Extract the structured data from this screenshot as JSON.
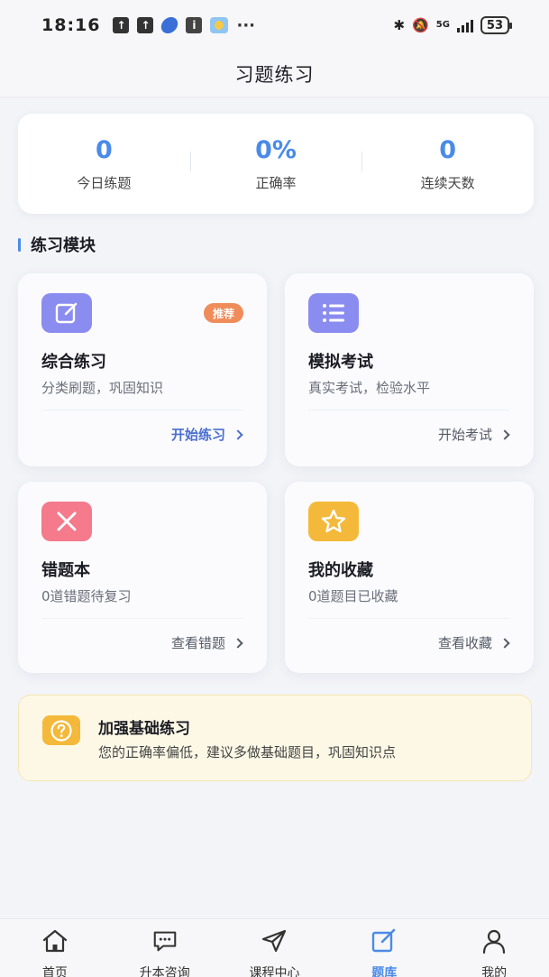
{
  "status_bar": {
    "time": "18:16",
    "network": "5G",
    "battery": "53"
  },
  "nav": {
    "title": "习题练习"
  },
  "stats": [
    {
      "value": "0",
      "label": "今日练题"
    },
    {
      "value": "0%",
      "label": "正确率"
    },
    {
      "value": "0",
      "label": "连续天数"
    }
  ],
  "section": {
    "title": "练习模块"
  },
  "modules": [
    {
      "title": "综合练习",
      "desc": "分类刷题，巩固知识",
      "action": "开始练习",
      "badge": "推荐",
      "icon": "edit-icon",
      "color": "#8b8cf0"
    },
    {
      "title": "模拟考试",
      "desc": "真实考试，检验水平",
      "action": "开始考试",
      "icon": "list-icon",
      "color": "#8b8cf0"
    },
    {
      "title": "错题本",
      "desc": "0道错题待复习",
      "action": "查看错题",
      "icon": "close-icon",
      "color": "#f47a8c"
    },
    {
      "title": "我的收藏",
      "desc": "0道题目已收藏",
      "action": "查看收藏",
      "icon": "star-icon",
      "color": "#f4b93a"
    }
  ],
  "tip": {
    "title": "加强基础练习",
    "text": "您的正确率偏低，建议多做基础题目，巩固知识点",
    "icon": "question-icon"
  },
  "tabs": [
    {
      "label": "首页",
      "icon": "home-icon",
      "active": false
    },
    {
      "label": "升本咨询",
      "icon": "chat-icon",
      "active": false
    },
    {
      "label": "课程中心",
      "icon": "send-icon",
      "active": false
    },
    {
      "label": "题库",
      "icon": "edit-icon",
      "active": true
    },
    {
      "label": "我的",
      "icon": "user-icon",
      "active": false
    }
  ],
  "colors": {
    "accent": "#4a8be8",
    "badge": "#f08c5a",
    "tip_bg": "#fdf8e6"
  }
}
